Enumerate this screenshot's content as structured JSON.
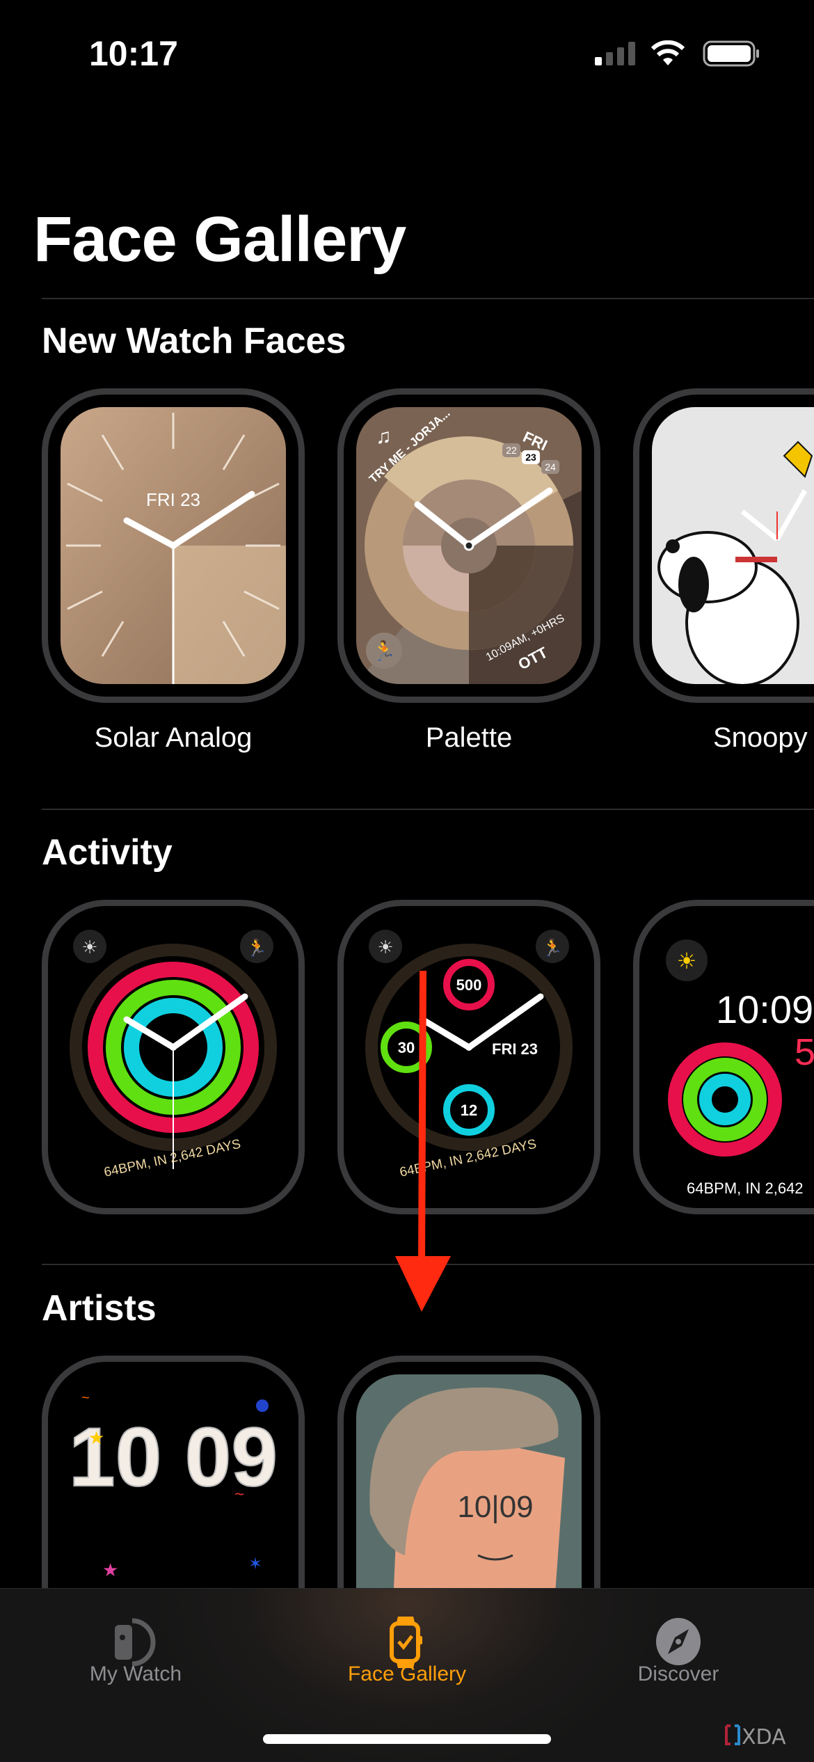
{
  "status": {
    "time": "10:17",
    "signal": "cellular-signal-icon",
    "wifi": "wifi-icon",
    "battery": "battery-icon"
  },
  "header": {
    "title": "Face Gallery"
  },
  "sections": [
    {
      "title": "New Watch Faces",
      "faces": [
        {
          "name": "Solar Analog",
          "date": "FRI 23"
        },
        {
          "name": "Palette",
          "complication_top": "TRY ME - JORJA...",
          "day": "FRI",
          "dates": [
            "22",
            "23",
            "24"
          ],
          "complication_bottom": "10:09AM, +0HRS",
          "city": "OTT"
        },
        {
          "name": "Snoopy"
        }
      ]
    },
    {
      "title": "Activity",
      "faces": [
        {
          "bottom": "64BPM, IN 2,642 DAYS"
        },
        {
          "move": "500",
          "exercise": "30",
          "stand": "12",
          "date": "FRI 23",
          "bottom": "64BPM, IN 2,642 DAYS"
        },
        {
          "time": "10:09",
          "move": "5",
          "bottom": "64BPM, IN 2,642"
        }
      ]
    },
    {
      "title": "Artists",
      "faces": [
        {
          "time": "10 09"
        },
        {
          "time": "10|09"
        }
      ]
    }
  ],
  "tabbar": {
    "items": [
      {
        "label": "My Watch",
        "icon": "watch-side-icon",
        "active": false
      },
      {
        "label": "Face Gallery",
        "icon": "watch-check-icon",
        "active": true
      },
      {
        "label": "Discover",
        "icon": "compass-icon",
        "active": false
      }
    ],
    "active_color": "#ff9f0a",
    "inactive_color": "#8e8e93"
  },
  "watermark": "XDA",
  "annotation_color": "#ff2a10"
}
